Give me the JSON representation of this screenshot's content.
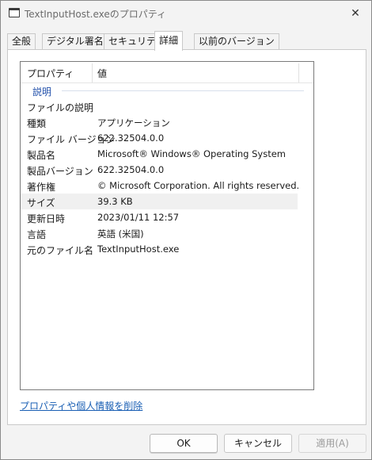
{
  "window": {
    "title": "TextInputHost.exeのプロパティ",
    "close_glyph": "✕"
  },
  "tabs": [
    {
      "label": "全般",
      "active": false
    },
    {
      "label": "デジタル署名",
      "active": false
    },
    {
      "label": "セキュリティ",
      "active": false
    },
    {
      "label": "詳細",
      "active": true
    },
    {
      "label": "以前のバージョン",
      "active": false
    }
  ],
  "details": {
    "columns": {
      "property": "プロパティ",
      "value": "値"
    },
    "group": "説明",
    "rows": [
      {
        "key": "ファイルの説明",
        "value": ""
      },
      {
        "key": "種類",
        "value": "アプリケーション"
      },
      {
        "key": "ファイル バージョン",
        "value": "622.32504.0.0"
      },
      {
        "key": "製品名",
        "value": "Microsoft® Windows® Operating System"
      },
      {
        "key": "製品バージョン",
        "value": "622.32504.0.0"
      },
      {
        "key": "著作権",
        "value": "© Microsoft Corporation.  All rights reserved."
      },
      {
        "key": "サイズ",
        "value": "39.3 KB",
        "selected": true
      },
      {
        "key": "更新日時",
        "value": "2023/01/11 12:57"
      },
      {
        "key": "言語",
        "value": "英語 (米国)"
      },
      {
        "key": "元のファイル名",
        "value": "TextInputHost.exe"
      }
    ]
  },
  "link": {
    "remove_properties": "プロパティや個人情報を削除"
  },
  "buttons": {
    "ok": "OK",
    "cancel": "キャンセル",
    "apply": "適用(A)"
  }
}
